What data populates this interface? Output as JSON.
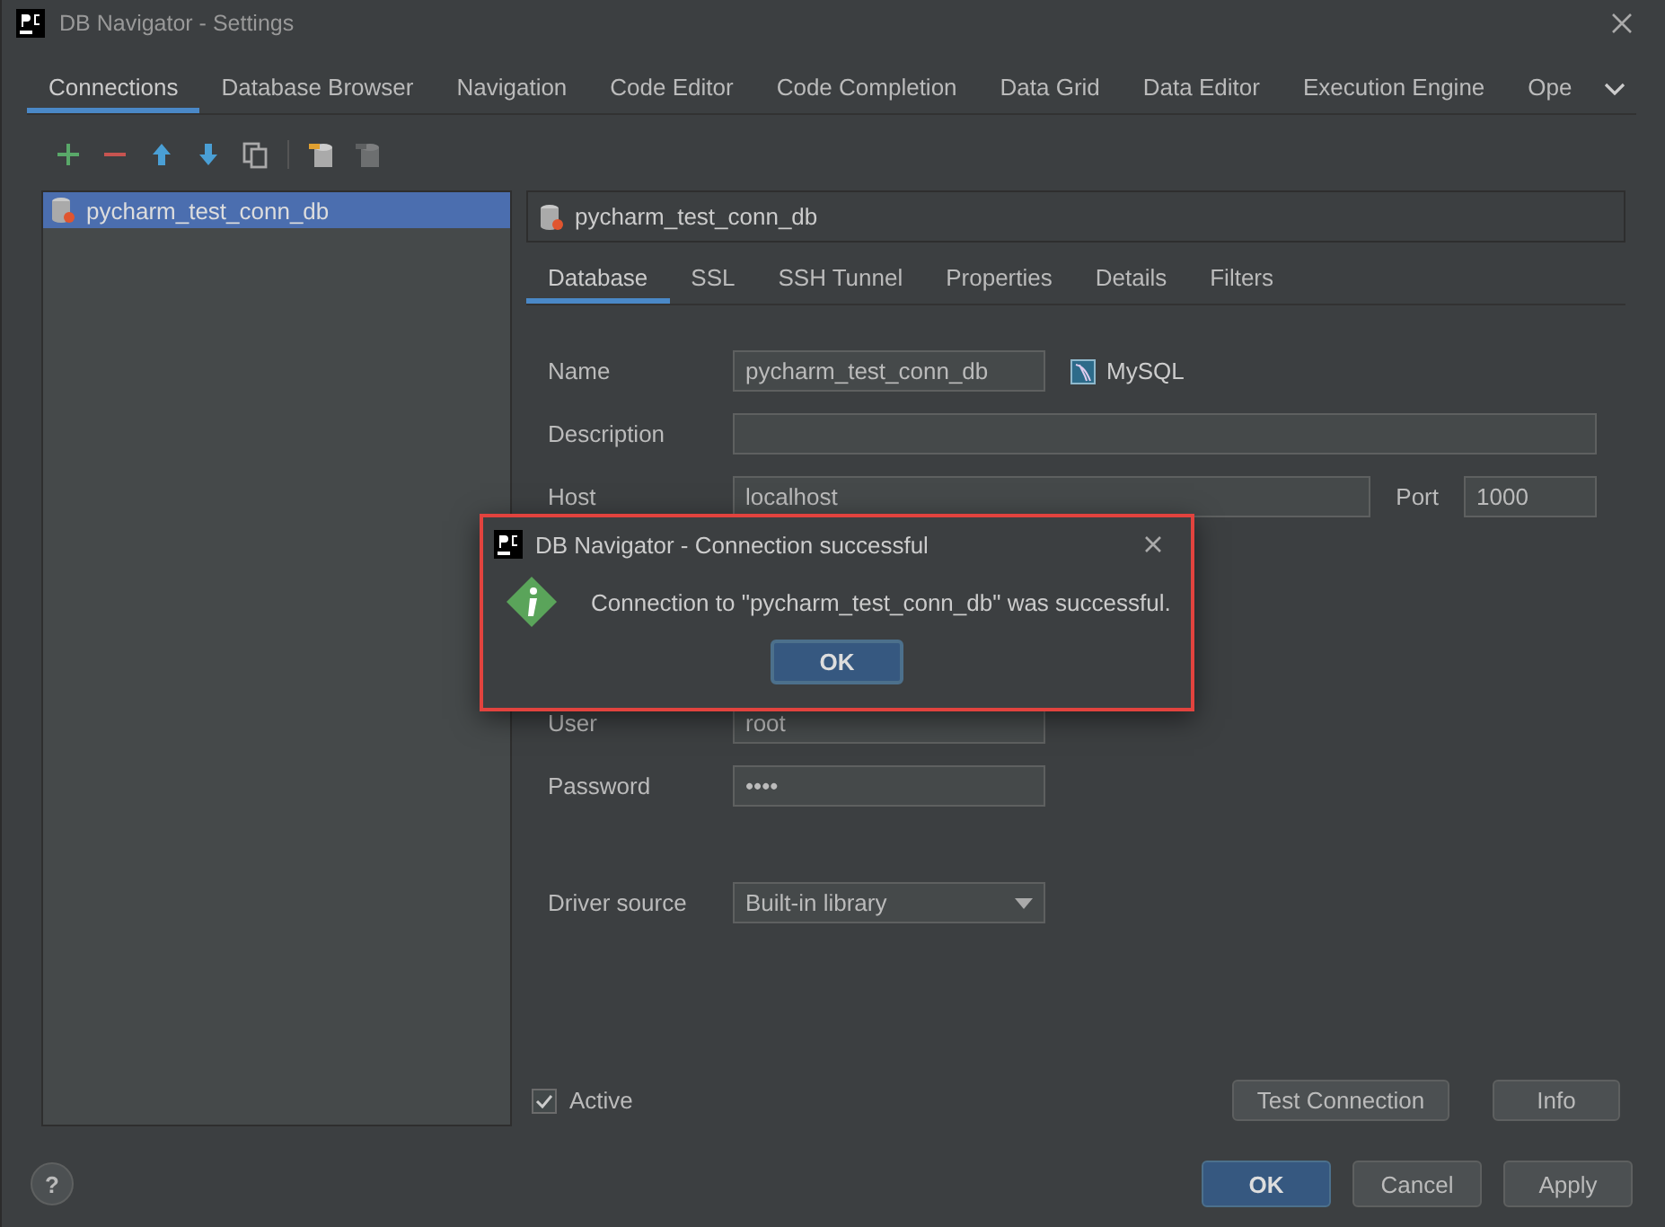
{
  "window": {
    "title": "DB Navigator - Settings"
  },
  "tabs": [
    {
      "label": "Connections",
      "selected": true
    },
    {
      "label": "Database Browser",
      "selected": false
    },
    {
      "label": "Navigation",
      "selected": false
    },
    {
      "label": "Code Editor",
      "selected": false
    },
    {
      "label": "Code Completion",
      "selected": false
    },
    {
      "label": "Data Grid",
      "selected": false
    },
    {
      "label": "Data Editor",
      "selected": false
    },
    {
      "label": "Execution Engine",
      "selected": false
    },
    {
      "label": "Ope",
      "selected": false
    }
  ],
  "toolbar": [
    {
      "kind": "add",
      "disabled": false
    },
    {
      "kind": "remove",
      "disabled": false
    },
    {
      "kind": "up",
      "disabled": false
    },
    {
      "kind": "down",
      "disabled": false
    },
    {
      "kind": "copy",
      "disabled": false
    },
    {
      "kind": "import",
      "disabled": false
    },
    {
      "kind": "export",
      "disabled": true
    }
  ],
  "connections": [
    {
      "label": "pycharm_test_conn_db",
      "selected": true
    }
  ],
  "header": {
    "title": "pycharm_test_conn_db"
  },
  "subtabs": [
    {
      "label": "Database",
      "selected": true
    },
    {
      "label": "SSL",
      "selected": false
    },
    {
      "label": "SSH Tunnel",
      "selected": false
    },
    {
      "label": "Properties",
      "selected": false
    },
    {
      "label": "Details",
      "selected": false
    },
    {
      "label": "Filters",
      "selected": false
    }
  ],
  "form": {
    "name": {
      "label": "Name",
      "value": "pycharm_test_conn_db"
    },
    "database_type": "MySQL",
    "description": {
      "label": "Description"
    },
    "host": {
      "label": "Host",
      "value": "localhost"
    },
    "port": {
      "label": "Port",
      "value": "1000"
    },
    "user": {
      "label": "User",
      "value": "root"
    },
    "password": {
      "label": "Password",
      "value": "••••"
    },
    "driver_source": {
      "label": "Driver source",
      "value": "Built-in library"
    }
  },
  "active": {
    "label": "Active",
    "checked": true
  },
  "actions": [
    "Test Connection",
    "Info"
  ],
  "dialog": {
    "title": "DB Navigator - Connection successful",
    "message": "Connection to \"pycharm_test_conn_db\" was successful.",
    "button": "OK",
    "highlighted": true
  },
  "help": "?",
  "buttons": [
    {
      "label": "OK",
      "kind": "primary"
    },
    {
      "label": "Cancel",
      "kind": "normal"
    },
    {
      "label": "Apply",
      "kind": "normal"
    }
  ]
}
